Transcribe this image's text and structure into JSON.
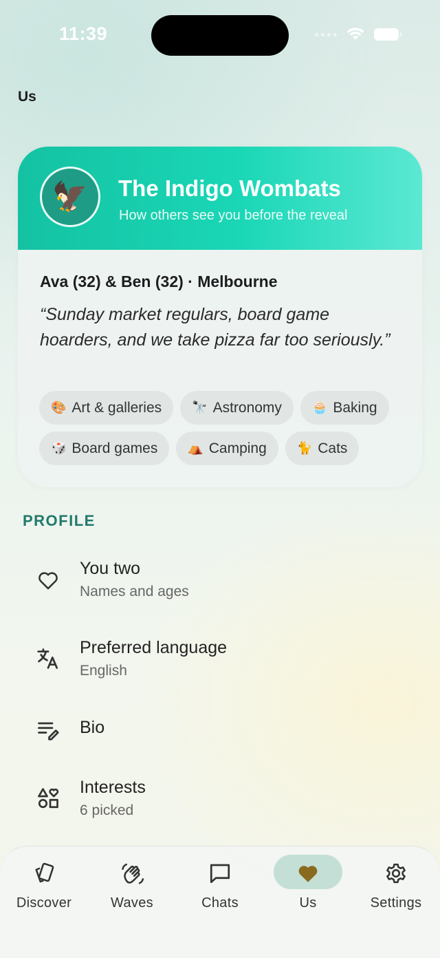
{
  "status": {
    "time": "11:39"
  },
  "page": {
    "title": "Us"
  },
  "card": {
    "avatar_icon": "eagle-icon",
    "team_name": "The Indigo Wombats",
    "subtitle": "How others see you before the reveal",
    "couple": "Ava (32) & Ben (32) · Melbourne",
    "quote": "“Sunday market regulars, board game hoarders, and we take pizza far too seriously.”",
    "interests": [
      {
        "emoji": "🎨",
        "label": "Art & galleries"
      },
      {
        "emoji": "🔭",
        "label": "Astronomy"
      },
      {
        "emoji": "🧁",
        "label": "Baking"
      },
      {
        "emoji": "🎲",
        "label": "Board games"
      },
      {
        "emoji": "⛺",
        "label": "Camping"
      },
      {
        "emoji": "🐈",
        "label": "Cats"
      }
    ]
  },
  "profile": {
    "section_label": "PROFILE",
    "items": [
      {
        "icon": "heart-outline-icon",
        "title": "You two",
        "subtitle": "Names and ages"
      },
      {
        "icon": "translate-icon",
        "title": "Preferred language",
        "subtitle": "English"
      },
      {
        "icon": "edit-note-icon",
        "title": "Bio",
        "subtitle": ""
      },
      {
        "icon": "shapes-icon",
        "title": "Interests",
        "subtitle": "6 picked"
      }
    ]
  },
  "nav": {
    "tabs": [
      {
        "icon": "cards-icon",
        "label": "Discover"
      },
      {
        "icon": "waving-hand-icon",
        "label": "Waves"
      },
      {
        "icon": "chat-bubble-icon",
        "label": "Chats"
      },
      {
        "icon": "heart-filled-icon",
        "label": "Us",
        "active": true
      },
      {
        "icon": "gear-icon",
        "label": "Settings"
      }
    ],
    "active_color": "#8a6a1f"
  },
  "colors": {
    "accent": "#1ad7b6",
    "section_label": "#207a6a"
  }
}
